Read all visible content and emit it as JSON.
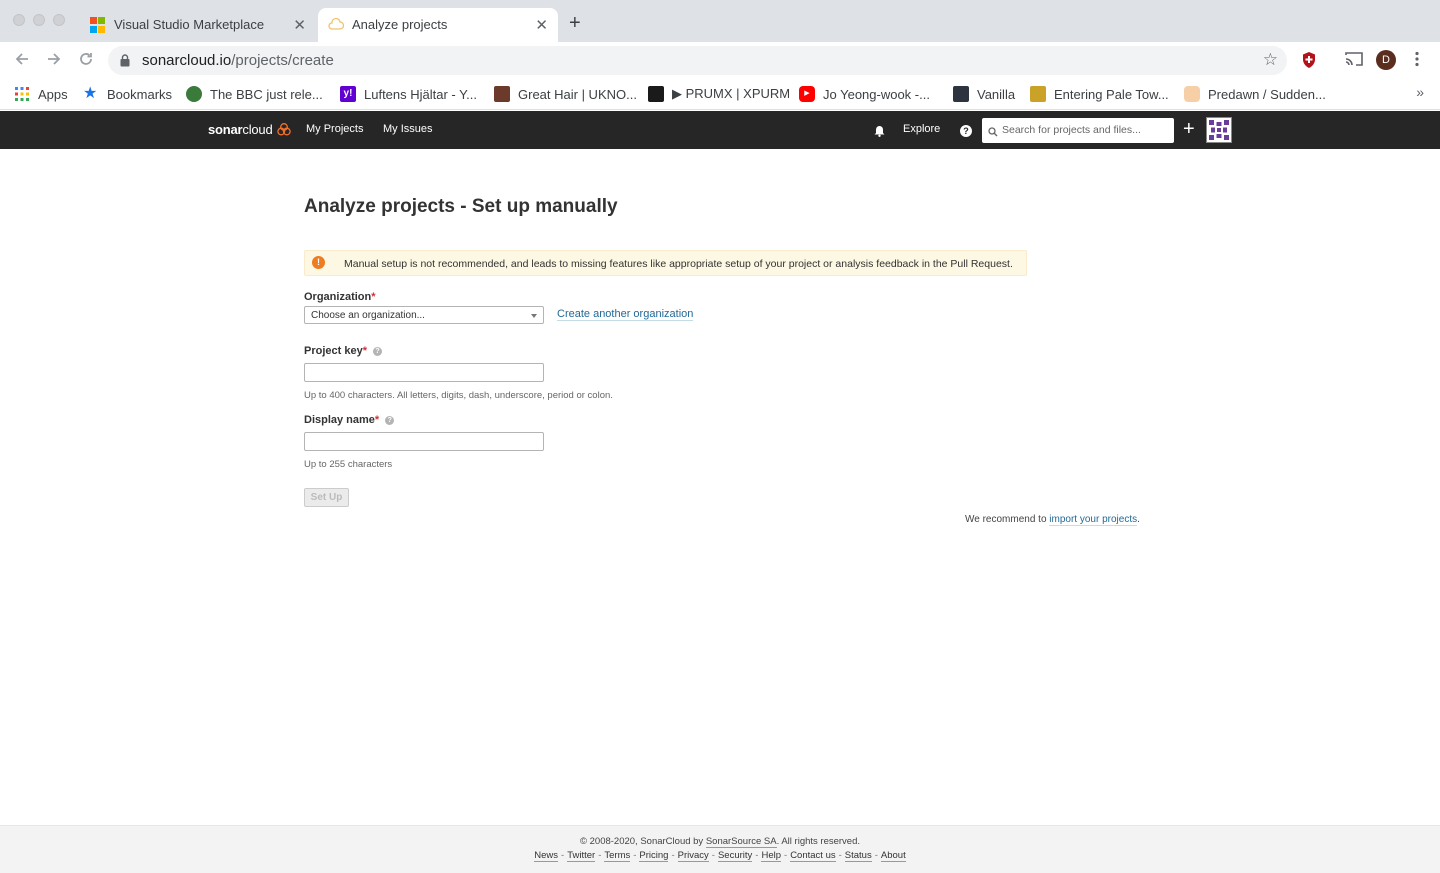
{
  "browser": {
    "tabs": [
      {
        "title": "Visual Studio Marketplace",
        "active": false
      },
      {
        "title": "Analyze projects",
        "active": true
      }
    ],
    "close_glyph": "✕",
    "new_tab_glyph": "+",
    "url_host": "sonarcloud.io",
    "url_path": "/projects/create",
    "profile_initial": "D",
    "bookmarks": [
      {
        "label": "Apps",
        "icon": "apps-grid-icon",
        "color": "#4285f4"
      },
      {
        "label": "Bookmarks",
        "icon": "star-icon",
        "color": "#1a73e8"
      },
      {
        "label": "The BBC just rele...",
        "icon": "bbc-icon",
        "color": "#3a7a3a"
      },
      {
        "label": "Luftens Hjältar - Y...",
        "icon": "yahoo-icon",
        "color": "#6001d2"
      },
      {
        "label": "Great Hair | UKNO...",
        "icon": "hair-icon",
        "color": "#6b3a2a"
      },
      {
        "label": "▶ PRUMX | XPURM",
        "icon": "prumx-icon",
        "color": "#1a1a1a"
      },
      {
        "label": "Jo Yeong-wook -...",
        "icon": "youtube-icon",
        "color": "#ff0000"
      },
      {
        "label": "Vanilla",
        "icon": "vanilla-icon",
        "color": "#2d3440"
      },
      {
        "label": "Entering Pale Tow...",
        "icon": "pale-tower-icon",
        "color": "#c9a227"
      },
      {
        "label": "Predawn / Sudden...",
        "icon": "predawn-icon",
        "color": "#f6cfa6"
      }
    ],
    "more_glyph": "»"
  },
  "sonar_nav": {
    "logo_bold": "sonar",
    "logo_light": "cloud",
    "my_projects": "My Projects",
    "my_issues": "My Issues",
    "explore": "Explore",
    "search_placeholder": "Search for projects and files...",
    "plus_glyph": "+"
  },
  "main": {
    "title_bold": "Analyze projects",
    "title_rest": " - Set up manually",
    "alert_icon": "!",
    "alert_text": "Manual setup is not recommended, and leads to missing features like appropriate setup of your project or analysis feedback in the Pull Request.",
    "organization_label": "Organization",
    "required_mark": "*",
    "organization_placeholder": "Choose an organization...",
    "create_org_link": "Create another organization",
    "project_key_label": "Project key",
    "project_key_value": "",
    "project_key_hint": "Up to 400 characters. All letters, digits, dash, underscore, period or colon.",
    "display_name_label": "Display name",
    "display_name_value": "",
    "display_name_hint": "Up to 255 characters",
    "help_glyph": "?",
    "setup_button": "Set Up",
    "recommend_prefix": "We recommend to ",
    "recommend_link": "import your projects",
    "recommend_suffix": "."
  },
  "footer": {
    "copyright_prefix": "© 2008-2020, SonarCloud by ",
    "copyright_company": "SonarSource SA",
    "copyright_suffix": ". All rights reserved.",
    "links": [
      "News",
      "Twitter",
      "Terms",
      "Pricing",
      "Privacy",
      "Security",
      "Help",
      "Contact us",
      "Status",
      "About"
    ],
    "separator": "-"
  },
  "colors": {
    "nav_bg": "#262626",
    "accent_link": "#236a97",
    "alert_bg": "#fcf8e3",
    "alert_icon": "#ed7d20",
    "required": "#d02f3a",
    "sonar_logo_mark": "#f3702a"
  }
}
